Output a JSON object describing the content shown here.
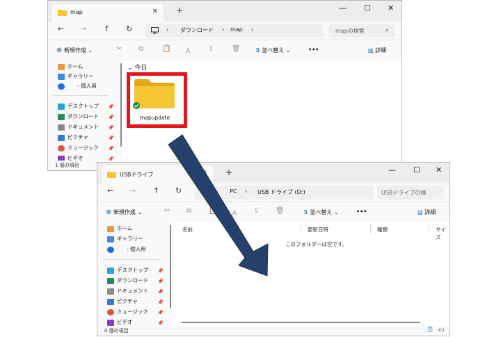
{
  "colors": {
    "arrow": "#24406b",
    "highlight": "#e8141b",
    "folder": "#f6c533",
    "accent": "#0067c0"
  },
  "win1": {
    "tab_title": "map",
    "breadcrumb": [
      "ダウンロード",
      "map"
    ],
    "search_placeholder": "mapの検索",
    "toolbar": {
      "new_label": "新規作成",
      "sort_label": "並べ替え",
      "more": "•••",
      "details_label": "詳細"
    },
    "group_label": "今日",
    "sidebar": {
      "quick": [
        {
          "label": "ホーム",
          "icon": "home-icon"
        },
        {
          "label": "ギャラリー",
          "icon": "gallery-icon"
        },
        {
          "label": "- 個人用",
          "icon": "onedrive-icon"
        }
      ],
      "pinned": [
        {
          "label": "デスクトップ",
          "icon": "desktop-icon"
        },
        {
          "label": "ダウンロード",
          "icon": "download-icon"
        },
        {
          "label": "ドキュメント",
          "icon": "documents-icon"
        },
        {
          "label": "ピクチャ",
          "icon": "pictures-icon"
        },
        {
          "label": "ミュージック",
          "icon": "music-icon"
        },
        {
          "label": "ビデオ",
          "icon": "videos-icon"
        }
      ]
    },
    "folder_name": "mapupdate",
    "status": "1 個の項目"
  },
  "win2": {
    "tab_title": "USBドライブ",
    "breadcrumb": [
      "PC",
      "USB ドライブ (D:)"
    ],
    "search_placeholder": "USBドライブの検",
    "toolbar": {
      "new_label": "新規作成",
      "sort_label": "並べ替え",
      "more": "•••",
      "details_label": "詳細"
    },
    "columns": [
      "名前",
      "更新日時",
      "種類",
      "サイズ"
    ],
    "empty_message": "このフォルダーは空です。",
    "sidebar": {
      "quick": [
        {
          "label": "ホーム",
          "icon": "home-icon"
        },
        {
          "label": "ギャラリー",
          "icon": "gallery-icon"
        },
        {
          "label": "- 個人用",
          "icon": "onedrive-icon"
        }
      ],
      "pinned": [
        {
          "label": "デスクトップ",
          "icon": "desktop-icon"
        },
        {
          "label": "ダウンロード",
          "icon": "download-icon"
        },
        {
          "label": "ドキュメント",
          "icon": "documents-icon"
        },
        {
          "label": "ピクチャ",
          "icon": "pictures-icon"
        },
        {
          "label": "ミュージック",
          "icon": "music-icon"
        },
        {
          "label": "ビデオ",
          "icon": "videos-icon"
        }
      ]
    },
    "status": "0 個の項目"
  }
}
